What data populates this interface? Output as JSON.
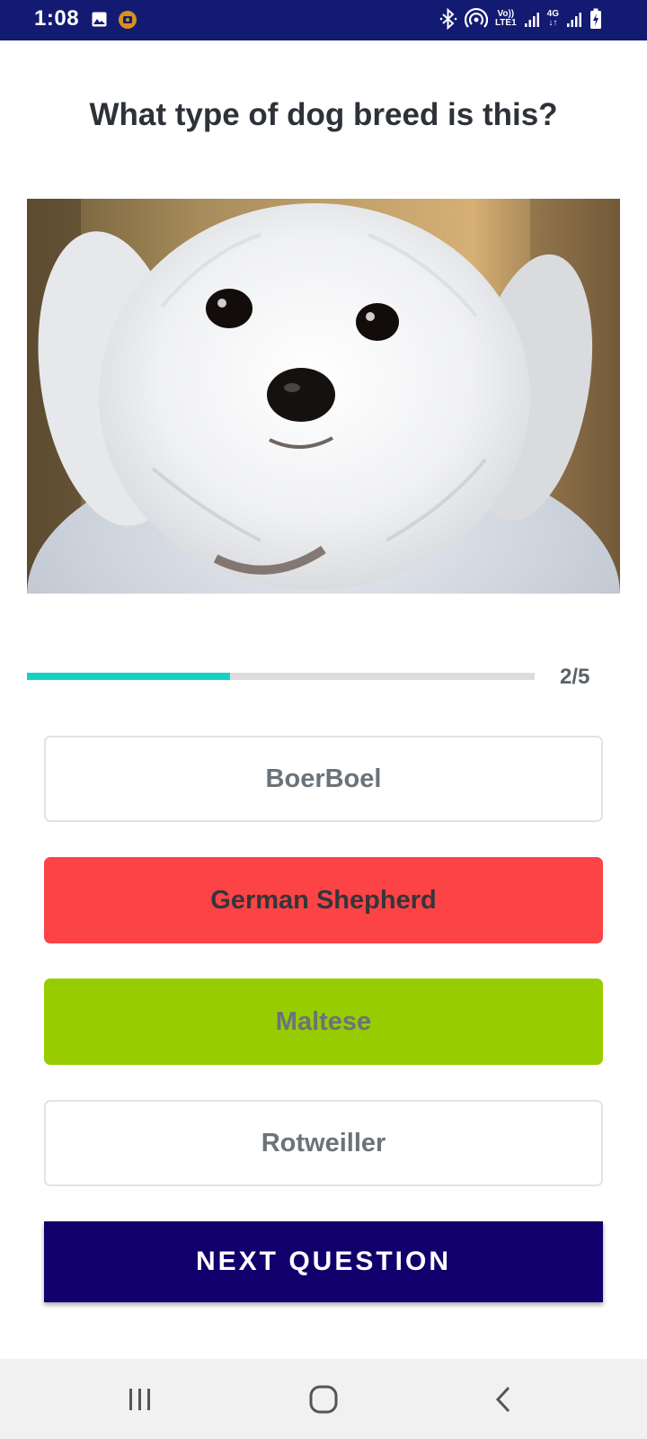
{
  "status_bar": {
    "time": "1:08",
    "volte_label": "Vo))",
    "lte_label": "LTE1",
    "network_label": "4G",
    "icons": [
      "gallery-icon",
      "screen-record-icon",
      "bluetooth-icon",
      "hotspot-icon",
      "signal-icon",
      "battery-icon"
    ]
  },
  "quiz": {
    "question": "What type of dog breed is this?",
    "progress": {
      "text": "2/5",
      "current": 2,
      "total": 5
    },
    "answers": [
      {
        "label": "BoerBoel",
        "state": "unselected"
      },
      {
        "label": "German Shepherd",
        "state": "wrong",
        "color": "#fc4346"
      },
      {
        "label": "Maltese",
        "state": "correct",
        "color": "#97cc00"
      },
      {
        "label": "Rotweiller",
        "state": "unselected"
      }
    ],
    "next_label": "NEXT QUESTION"
  },
  "colors": {
    "status_bar": "#131a72",
    "progress_fill": "#12d1c5",
    "next_button": "#11006b"
  },
  "nav_bar": {
    "icons": [
      "recent-apps-icon",
      "home-icon",
      "back-icon"
    ]
  }
}
